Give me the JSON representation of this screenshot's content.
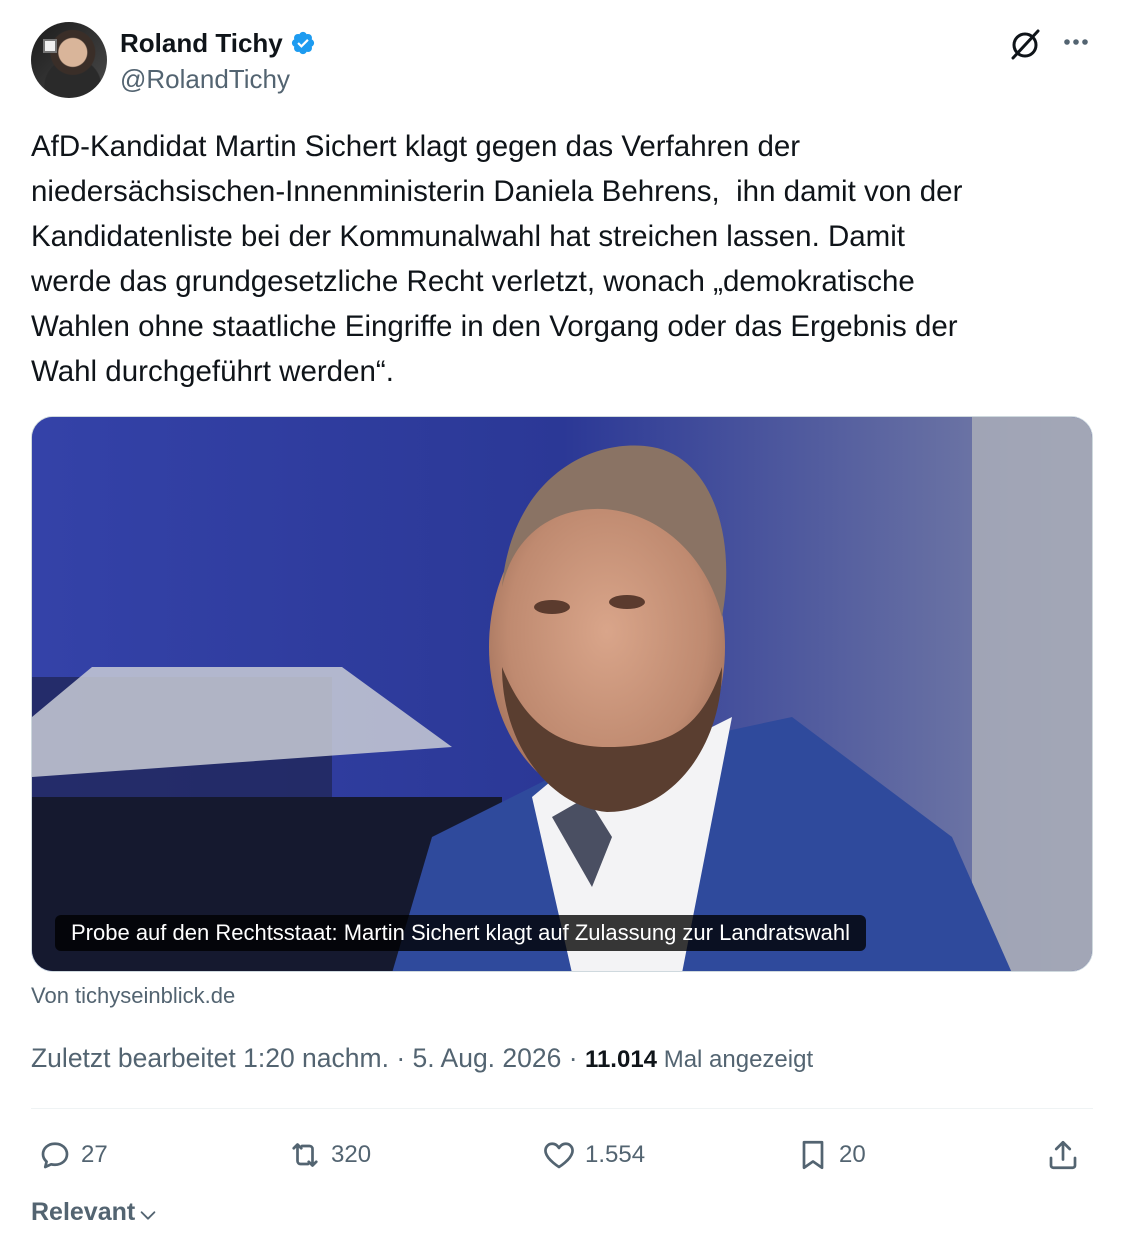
{
  "author": {
    "name": "Roland Tichy",
    "handle": "@RolandTichy",
    "verified": true
  },
  "tweet": {
    "text": "AfD-Kandidat Martin Sichert klagt gegen das Verfahren der\nniedersächsischen-Innenministerin Daniela Behrens,  ihn damit von der\nKandidatenliste bei der Kommunalwahl hat streichen lassen. Damit\nwerde das grundgesetzliche Recht verletzt, wonach „demokratische\nWahlen ohne staatliche Eingriffe in den Vorgang oder das Ergebnis der\nWahl durchgeführt werden“."
  },
  "link_card": {
    "caption": "Probe auf den Rechtsstaat: Martin Sichert klagt auf Zulassung zur Landratswahl",
    "source": "Von tichyseinblick.de"
  },
  "meta": {
    "edited": "Zuletzt bearbeitet 1:20 nachm.",
    "separator": " · ",
    "date": "5. Aug. 2026",
    "views_count": "11.014",
    "views_label": " Mal angezeigt"
  },
  "actions": {
    "replies": "27",
    "reposts": "320",
    "likes": "1.554",
    "bookmarks": "20"
  },
  "sort": {
    "label": "Relevant"
  },
  "icons": {
    "grok": "grok-icon",
    "more": "more-icon",
    "reply": "reply-icon",
    "repost": "repost-icon",
    "like": "heart-icon",
    "bookmark": "bookmark-icon",
    "share": "share-icon",
    "verified": "verified-badge-icon"
  },
  "colors": {
    "text": "#0f1419",
    "secondary": "#536471",
    "verified": "#1d9bf0",
    "divider": "#eff3f4"
  }
}
